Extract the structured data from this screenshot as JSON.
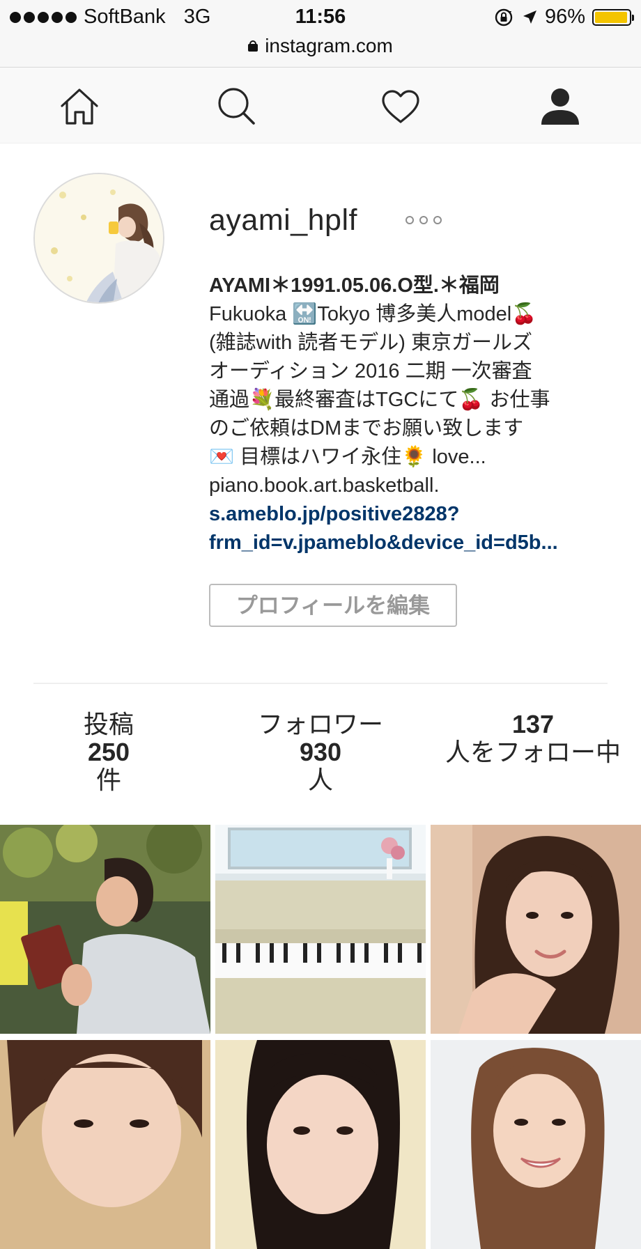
{
  "status_bar": {
    "carrier": "SoftBank",
    "network": "3G",
    "time": "11:56",
    "battery": "96%",
    "battery_level": 0.96,
    "battery_color": "#f4c400",
    "icons": [
      "signal-dots-icon",
      "rotation-lock-icon",
      "location-arrow-icon",
      "battery-icon"
    ]
  },
  "browser": {
    "url": "instagram.com",
    "icon": "lock-icon"
  },
  "nav": {
    "items": [
      {
        "icon": "home-icon"
      },
      {
        "icon": "search-icon"
      },
      {
        "icon": "heart-icon"
      },
      {
        "icon": "profile-icon"
      }
    ]
  },
  "profile": {
    "username": "ayami_hplf",
    "more_icon": "more-options-icon",
    "full_name": "AYAMI＊1991.05.06.O型.＊福岡",
    "bio_lines": [
      "Fukuoka 🔛Tokyo 博多美人model🍒",
      "(雑誌with 読者モデル) 東京ガールズ",
      "オーディション 2016 二期 一次審査",
      "通過💐最終審査はTGCにて🍒 お仕事",
      "のご依頼はDMまでお願い致します",
      "💌 目標はハワイ永住🌻 love...",
      "piano.book.art.basketball."
    ],
    "link_line1": "s.ameblo.jp/positive2828?",
    "link_line2": "frm_id=v.jpameblo&device_id=d5b...",
    "edit_button": "プロフィールを編集"
  },
  "stats": {
    "posts": {
      "label_top": "投稿",
      "value": "250",
      "label_bottom": "件"
    },
    "followers": {
      "label_top": "フォロワー",
      "value": "930",
      "label_bottom": "人"
    },
    "following": {
      "value": "137",
      "label_bottom": "人をフォロー中"
    }
  },
  "colors": {
    "link": "#003569",
    "text": "#262626",
    "border": "#dbdbdb"
  },
  "posts_grid": [
    {
      "kind": "photo",
      "subject": "reading-book"
    },
    {
      "kind": "photo",
      "subject": "piano"
    },
    {
      "kind": "photo",
      "subject": "portrait"
    },
    {
      "kind": "photo",
      "subject": "portrait"
    },
    {
      "kind": "photo",
      "subject": "portrait"
    },
    {
      "kind": "photo",
      "subject": "portrait"
    }
  ]
}
